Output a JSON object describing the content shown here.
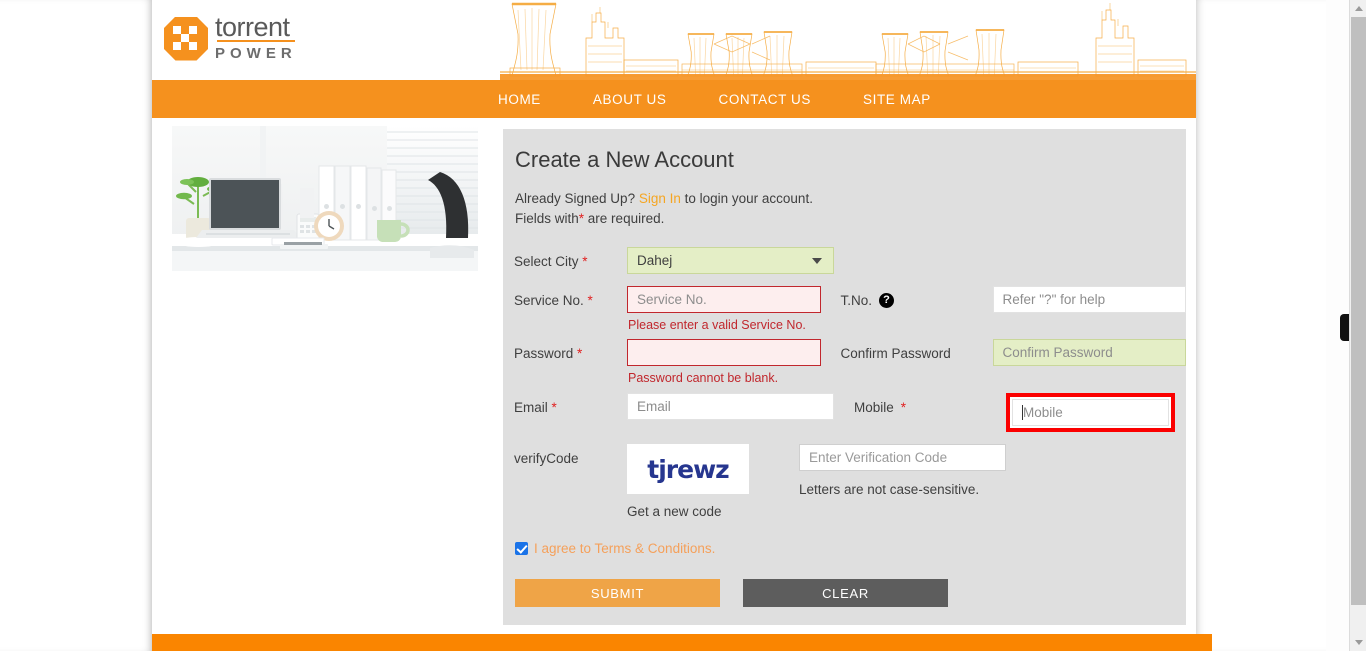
{
  "brand": {
    "logo_primary": "torrent",
    "logo_secondary": "POWER",
    "accent_orange": "#F5911E",
    "nav_orange": "#F5911E",
    "footer_orange": "#FA8500"
  },
  "nav": {
    "items": [
      {
        "label": "HOME"
      },
      {
        "label": "ABOUT US"
      },
      {
        "label": "CONTACT US"
      },
      {
        "label": "SITE MAP"
      }
    ]
  },
  "panel": {
    "title": "Create a New Account",
    "intro_prefix": "Already Signed Up? ",
    "intro_link": "Sign In",
    "intro_suffix": " to login your account.",
    "required_prefix": "Fields with",
    "required_star": "*",
    "required_suffix": " are required."
  },
  "form": {
    "city": {
      "label": "Select City ",
      "star": "*",
      "value": "Dahej"
    },
    "service_no": {
      "label": "Service No. ",
      "star": "*",
      "placeholder": "Service No.",
      "value": "",
      "error": "Please enter a valid Service No."
    },
    "tno": {
      "label": "T.No.",
      "help_icon": "question-mark-icon",
      "placeholder": "Refer \"?\" for help",
      "value": ""
    },
    "password": {
      "label": "Password ",
      "star": "*",
      "placeholder": "",
      "value": "",
      "error": "Password cannot be blank."
    },
    "confirm_password": {
      "label": "Confirm Password",
      "placeholder": "Confirm Password",
      "value": ""
    },
    "email": {
      "label": "Email ",
      "star": "*",
      "placeholder": "Email",
      "value": ""
    },
    "mobile": {
      "label": "Mobile ",
      "star": "*",
      "placeholder": "Mobile",
      "value": "",
      "focus_highlight_color": "#fb0000"
    },
    "verify": {
      "label": "verifyCode",
      "captcha_text": "tjrewz",
      "captcha_color": "#26368f",
      "new_code_label": "Get a new code",
      "input_placeholder": "Enter Verification Code",
      "input_value": "",
      "case_note": "Letters are not case-sensitive."
    },
    "agree": {
      "checked": true,
      "label": "I agree to Terms & Conditions."
    },
    "buttons": {
      "submit": "SUBMIT",
      "clear": "CLEAR"
    }
  }
}
